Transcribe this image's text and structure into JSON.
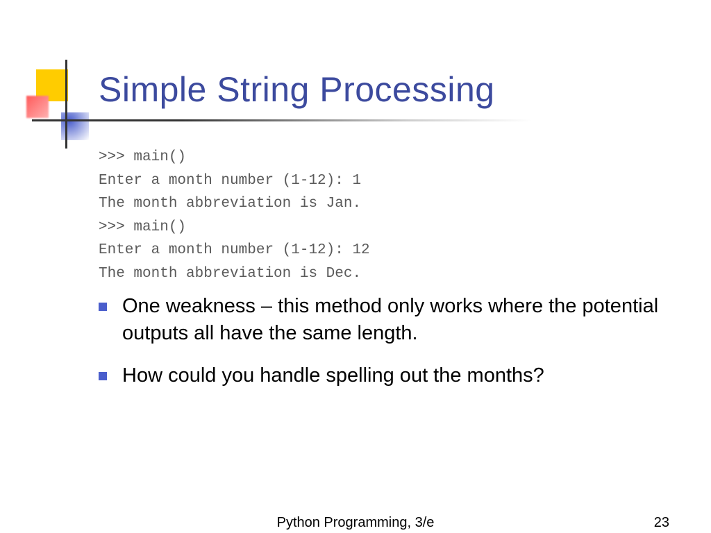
{
  "title": "Simple String Processing",
  "code_lines": [
    ">>> main()",
    "Enter a month number (1-12): 1",
    "The month abbreviation is Jan.",
    ">>> main()",
    "Enter a month number (1-12): 12",
    "The month abbreviation is Dec."
  ],
  "bullets": [
    "One weakness – this method only works where the potential outputs all have the same length.",
    "How could you handle spelling out the months?"
  ],
  "footer": {
    "text": "Python Programming, 3/e",
    "page": "23"
  }
}
